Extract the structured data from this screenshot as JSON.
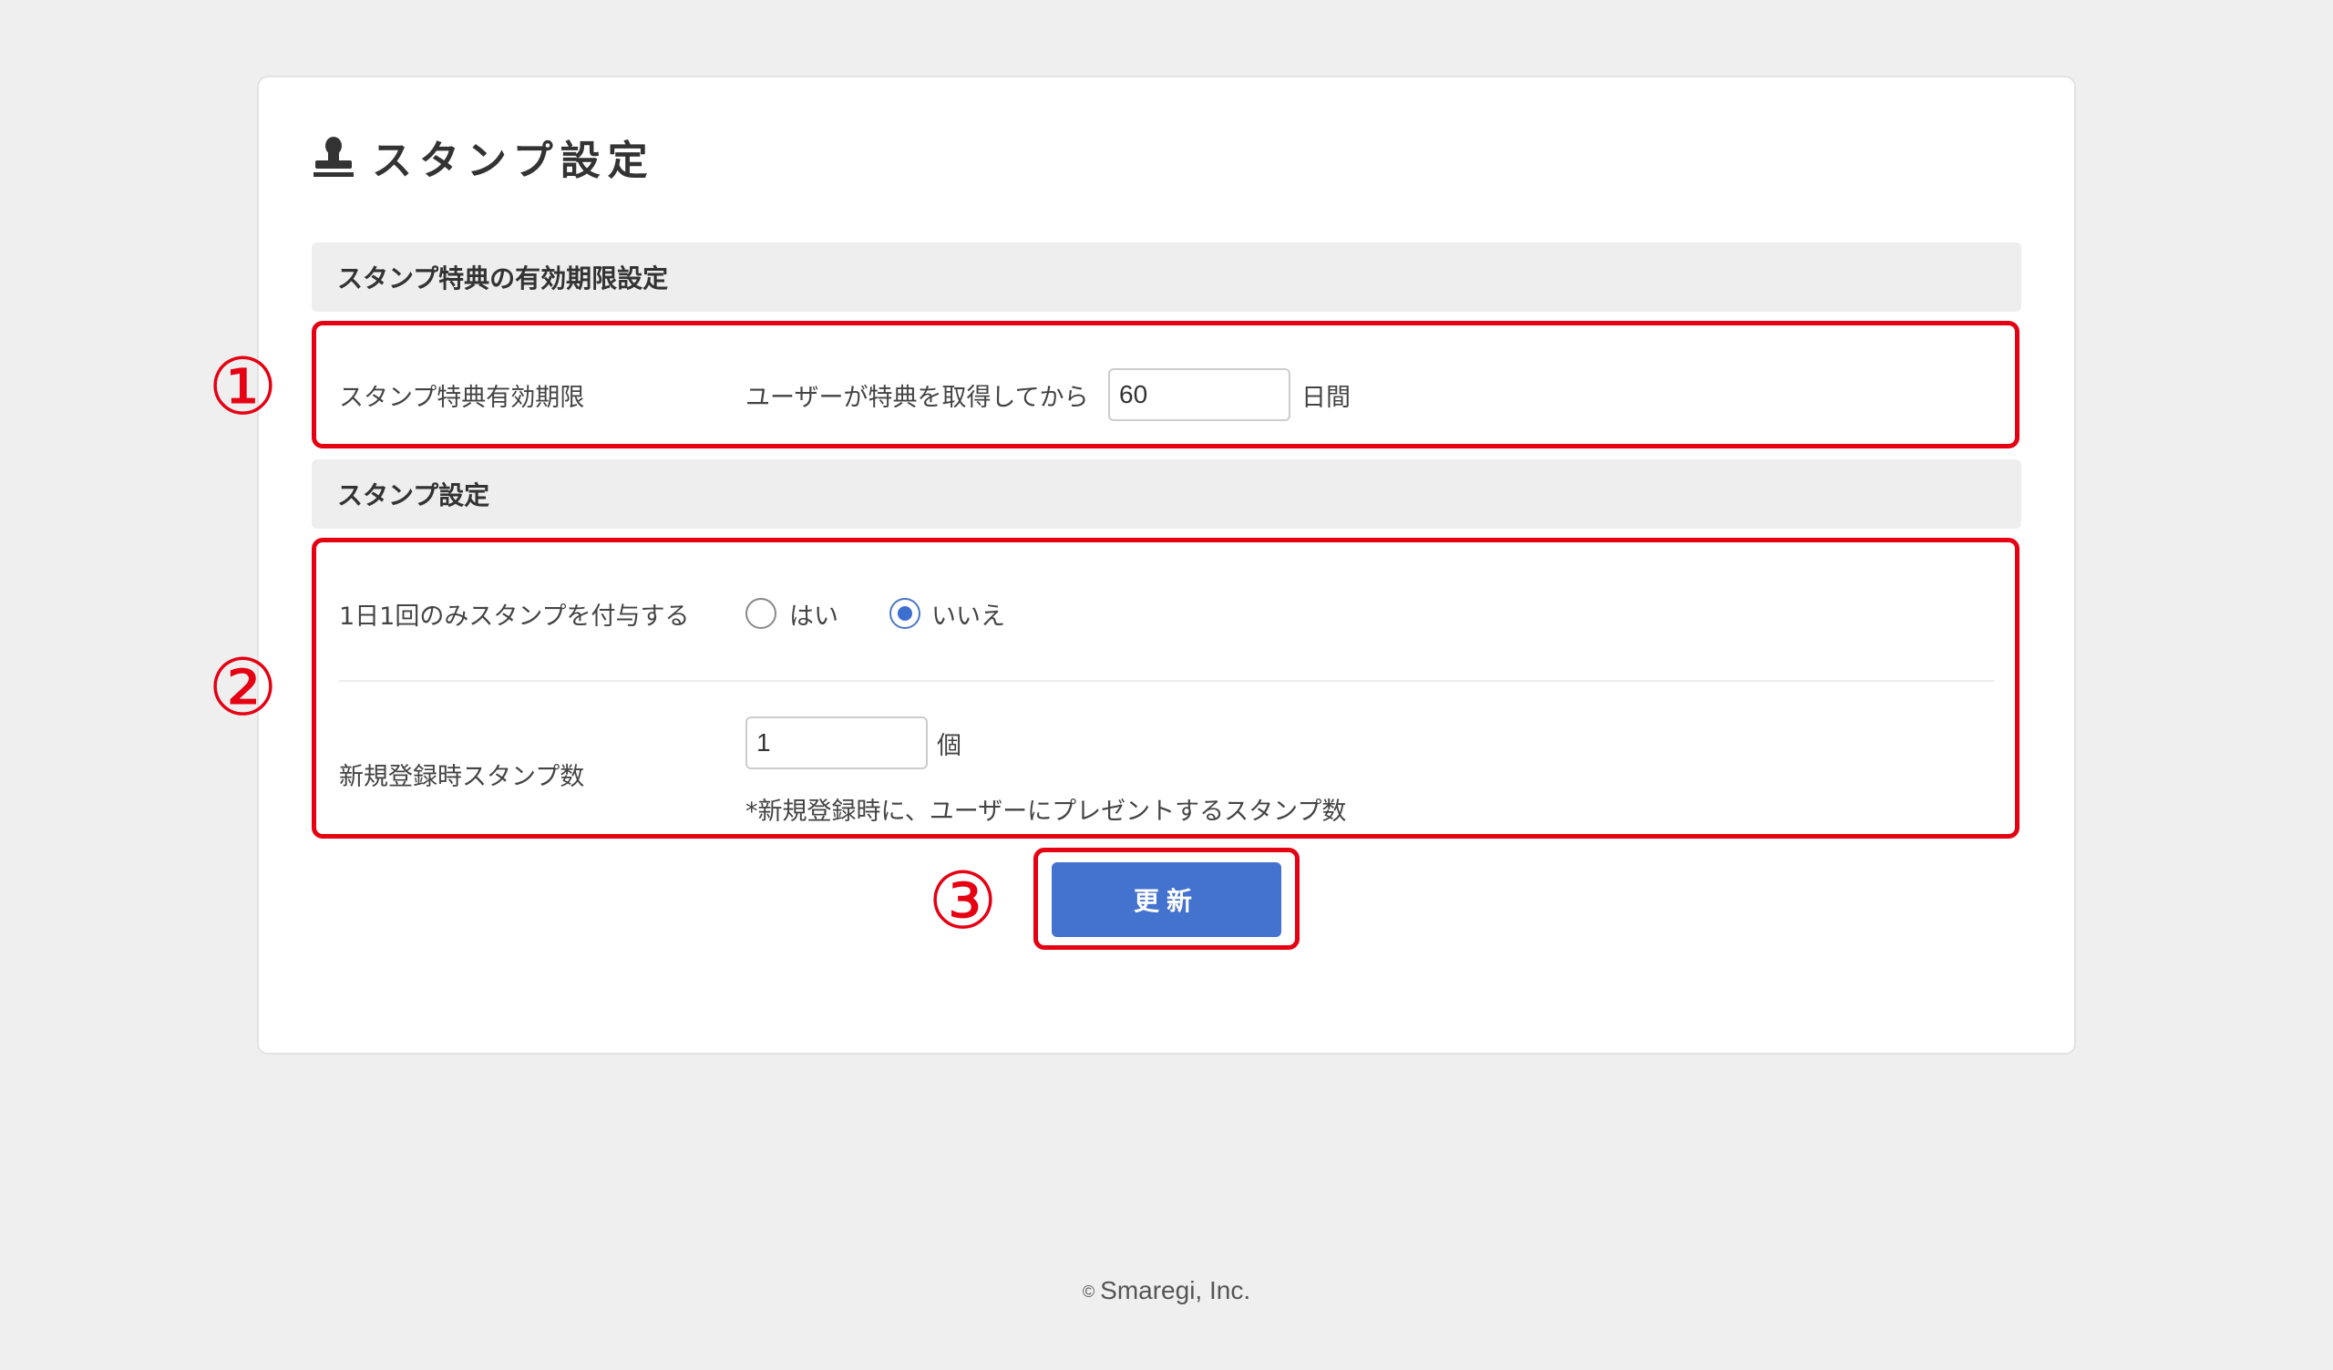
{
  "page": {
    "title": "スタンプ設定",
    "icon": "stamp-icon"
  },
  "section_expiry": {
    "header": "スタンプ特典の有効期限設定",
    "field_label": "スタンプ特典有効期限",
    "prefix_text": "ユーザーが特典を取得してから",
    "value": "60",
    "unit": "日間"
  },
  "section_stamp": {
    "header": "スタンプ設定",
    "once_per_day": {
      "label": "1日1回のみスタンプを付与する",
      "options": [
        {
          "label": "はい",
          "selected": false
        },
        {
          "label": "いいえ",
          "selected": true
        }
      ]
    },
    "signup_stamps": {
      "label": "新規登録時スタンプ数",
      "value": "1",
      "unit": "個",
      "help": "*新規登録時に、ユーザーにプレゼントするスタンプ数"
    }
  },
  "actions": {
    "update_label": "更新"
  },
  "annotations": [
    "①",
    "②",
    "③"
  ],
  "footer": {
    "copyright_symbol": "©",
    "company": "Smaregi, Inc."
  },
  "colors": {
    "accent": "#4472cf",
    "highlight": "#e50012",
    "background": "#efefef"
  }
}
